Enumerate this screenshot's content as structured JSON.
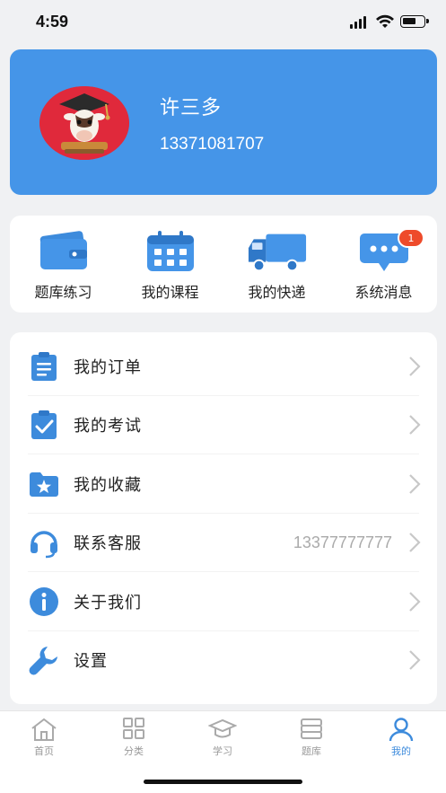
{
  "status": {
    "time": "4:59"
  },
  "profile": {
    "name": "许三多",
    "phone": "13371081707"
  },
  "shortcuts": [
    {
      "label": "题库练习",
      "icon": "wallet-icon"
    },
    {
      "label": "我的课程",
      "icon": "calendar-icon"
    },
    {
      "label": "我的快递",
      "icon": "truck-icon"
    },
    {
      "label": "系统消息",
      "icon": "message-icon",
      "badge": "1"
    }
  ],
  "menu": [
    {
      "label": "我的订单",
      "icon": "clipboard-icon"
    },
    {
      "label": "我的考试",
      "icon": "check-clipboard-icon"
    },
    {
      "label": "我的收藏",
      "icon": "star-folder-icon"
    },
    {
      "label": "联系客服",
      "icon": "headset-icon",
      "value": "13377777777"
    },
    {
      "label": "关于我们",
      "icon": "info-icon"
    },
    {
      "label": "设置",
      "icon": "wrench-icon"
    }
  ],
  "tabs": [
    {
      "label": "首页",
      "icon": "home-icon"
    },
    {
      "label": "分类",
      "icon": "grid-icon"
    },
    {
      "label": "学习",
      "icon": "graduation-cap-icon"
    },
    {
      "label": "题库",
      "icon": "books-icon"
    },
    {
      "label": "我的",
      "icon": "user-icon",
      "active": true
    }
  ],
  "colors": {
    "accent": "#4595e8",
    "badge": "#ee4b2b",
    "icon_blue": "#3d8bdc",
    "tab_active": "#3d8bdc"
  }
}
